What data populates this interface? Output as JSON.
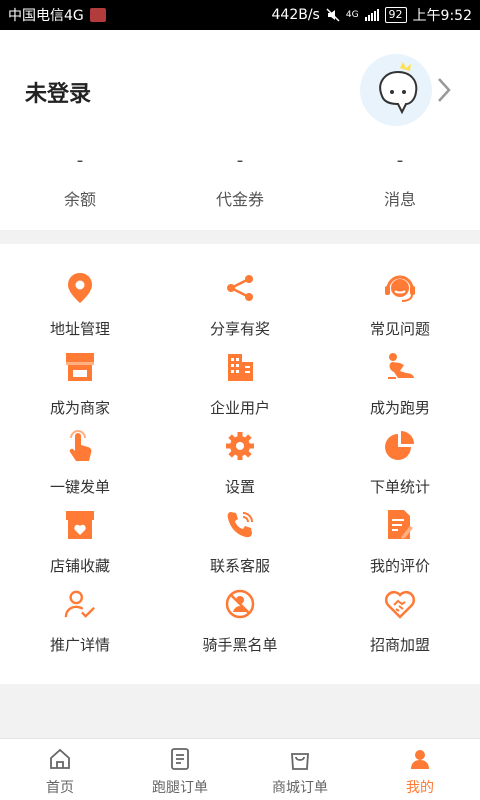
{
  "status_bar": {
    "carrier": "中国电信4G",
    "speed": "442B/s",
    "network": "4G",
    "battery": "92",
    "time": "上午9:52"
  },
  "profile": {
    "username": "未登录",
    "stats": [
      {
        "value": "-",
        "label": "余额"
      },
      {
        "value": "-",
        "label": "代金券"
      },
      {
        "value": "-",
        "label": "消息"
      }
    ]
  },
  "menu": [
    {
      "icon": "location-pin-icon",
      "label": "地址管理"
    },
    {
      "icon": "share-icon",
      "label": "分享有奖"
    },
    {
      "icon": "customer-service-icon",
      "label": "常见问题"
    },
    {
      "icon": "shop-icon",
      "label": "成为商家"
    },
    {
      "icon": "building-icon",
      "label": "企业用户"
    },
    {
      "icon": "runner-icon",
      "label": "成为跑男"
    },
    {
      "icon": "tap-hand-icon",
      "label": "一键发单"
    },
    {
      "icon": "gear-icon",
      "label": "设置"
    },
    {
      "icon": "pie-chart-icon",
      "label": "下单统计"
    },
    {
      "icon": "store-favorite-icon",
      "label": "店铺收藏"
    },
    {
      "icon": "phone-icon",
      "label": "联系客服"
    },
    {
      "icon": "review-edit-icon",
      "label": "我的评价"
    },
    {
      "icon": "user-check-icon",
      "label": "推广详情"
    },
    {
      "icon": "rider-blacklist-icon",
      "label": "骑手黑名单"
    },
    {
      "icon": "handshake-heart-icon",
      "label": "招商加盟"
    }
  ],
  "bottom_nav": [
    {
      "icon": "home-icon",
      "label": "首页",
      "active": false
    },
    {
      "icon": "order-icon",
      "label": "跑腿订单",
      "active": false
    },
    {
      "icon": "shopping-bag-icon",
      "label": "商城订单",
      "active": false
    },
    {
      "icon": "profile-icon",
      "label": "我的",
      "active": true
    }
  ],
  "colors": {
    "accent": "#ff7a35",
    "status_bar": "#000000",
    "background": "#f2f2f2"
  }
}
